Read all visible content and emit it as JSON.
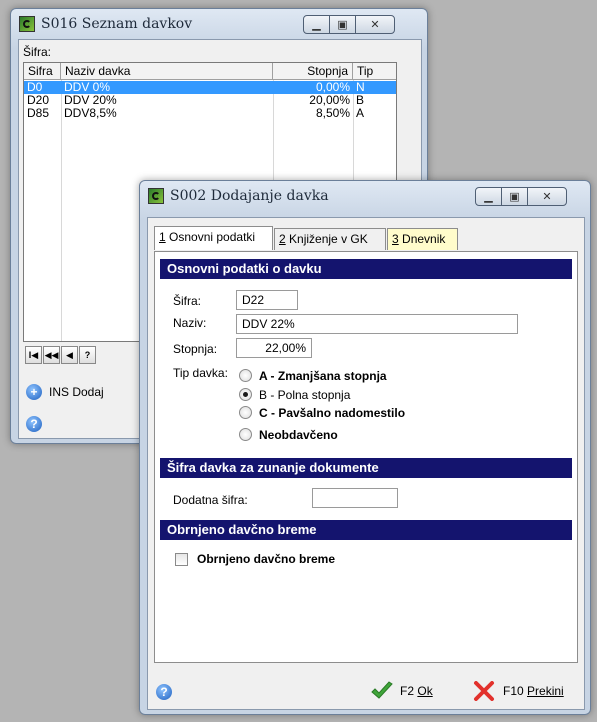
{
  "list_window": {
    "title": "S016 Seznam davkov",
    "sifra_label": "Šifra:",
    "columns": [
      "Sifra",
      "Naziv davka",
      "Stopnja",
      "Tip"
    ],
    "rows": [
      {
        "sifra": "D0",
        "naziv": "DDV 0%",
        "stopnja": "0,00%",
        "tip": "N",
        "selected": true
      },
      {
        "sifra": "D20",
        "naziv": "DDV 20%",
        "stopnja": "20,00%",
        "tip": "B",
        "selected": false
      },
      {
        "sifra": "D85",
        "naziv": "DDV8,5%",
        "stopnja": "8,50%",
        "tip": "A",
        "selected": false
      }
    ],
    "nav_buttons": [
      "I◀",
      "◀◀",
      "◀",
      "?"
    ],
    "add_label": "INS Dodaj"
  },
  "dialog": {
    "title": "S002 Dodajanje davka",
    "tabs": [
      {
        "key": "1",
        "label": "Osnovni podatki"
      },
      {
        "key": "2",
        "label": "Knjiženje v GK"
      },
      {
        "key": "3",
        "label": "Dnevnik"
      }
    ],
    "section1": "Osnovni podatki o davku",
    "sifra_label": "Šifra:",
    "sifra_value": "D22",
    "naziv_label": "Naziv:",
    "naziv_value": "DDV 22%",
    "stopnja_label": "Stopnja:",
    "stopnja_value": "22,00%",
    "tip_label": "Tip davka:",
    "tip_options": [
      {
        "label": "A - Zmanjšana stopnja",
        "selected": false
      },
      {
        "label": "B - Polna stopnja",
        "selected": true
      },
      {
        "label": "C - Pavšalno nadomestilo",
        "selected": false
      },
      {
        "label": "Neobdavčeno",
        "selected": false
      }
    ],
    "section2": "Šifra davka za zunanje dokumente",
    "dodatna_label": "Dodatna šifra:",
    "dodatna_value": "",
    "section3": "Obrnjeno davčno breme",
    "checkbox_label": "Obrnjeno davčno breme",
    "ok_key": "F2",
    "ok_label": "Ok",
    "cancel_key": "F10",
    "cancel_label": "Prekini"
  },
  "colors": {
    "section_bg": "#14146e",
    "selection": "#3399ff",
    "tab_yellow": "#fffccb"
  }
}
